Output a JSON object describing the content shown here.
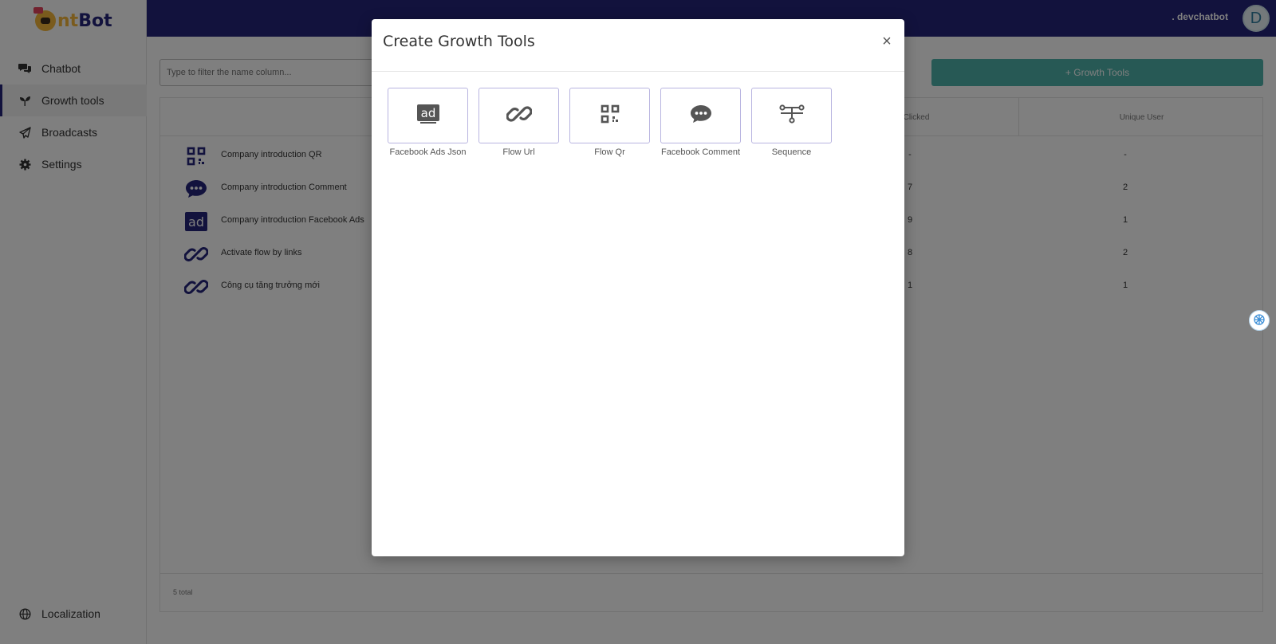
{
  "brand": {
    "logo_nt": "nt",
    "logo_bot": "Bot"
  },
  "sidebar": {
    "items": [
      {
        "label": "Chatbot",
        "icon": "chat-icon"
      },
      {
        "label": "Growth tools",
        "icon": "sprout-icon"
      },
      {
        "label": "Broadcasts",
        "icon": "paper-plane-icon"
      },
      {
        "label": "Settings",
        "icon": "gear-icon"
      }
    ],
    "footer_item": {
      "label": "Localization",
      "icon": "globe-icon"
    }
  },
  "header": {
    "user_name": ". devchatbot",
    "avatar_initial": "D"
  },
  "main": {
    "filter_placeholder": "Type to filter the name column...",
    "add_button_label": "+ Growth Tools",
    "table": {
      "columns": [
        "Clicked",
        "Unique User"
      ],
      "rows": [
        {
          "icon": "qr-icon",
          "name": "Company introduction QR",
          "clicked": "-",
          "unique": "-"
        },
        {
          "icon": "comment-icon",
          "name": "Company introduction Comment",
          "clicked": "7",
          "unique": "2"
        },
        {
          "icon": "ad-icon",
          "name": "Company introduction Facebook Ads",
          "clicked": "9",
          "unique": "1"
        },
        {
          "icon": "link-icon",
          "name": "Activate flow by links",
          "clicked": "8",
          "unique": "2"
        },
        {
          "icon": "link-icon",
          "name": "Công cụ tăng trưởng mới",
          "clicked": "1",
          "unique": "1"
        }
      ],
      "total": "5 total"
    }
  },
  "modal": {
    "title": "Create Growth Tools",
    "close_glyph": "×",
    "tools": [
      {
        "label": "Facebook Ads Json",
        "icon": "ad-icon"
      },
      {
        "label": "Flow Url",
        "icon": "link-icon"
      },
      {
        "label": "Flow Qr",
        "icon": "qr-icon"
      },
      {
        "label": "Facebook Comment",
        "icon": "comment-icon"
      },
      {
        "label": "Sequence",
        "icon": "sequence-icon"
      }
    ]
  },
  "colors": {
    "nav_bg": "#24247a",
    "accent": "#4fb3ab",
    "tool_border": "#b8b4e0"
  }
}
